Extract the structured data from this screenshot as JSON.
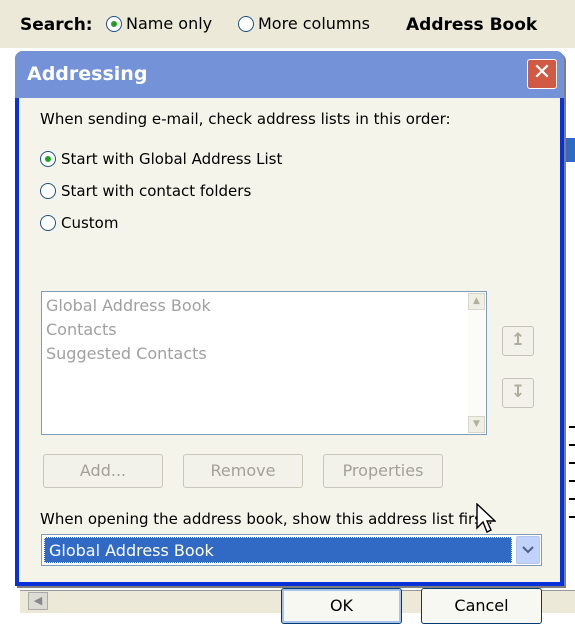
{
  "background": {
    "search_label": "Search:",
    "radio_name_only": "Name only",
    "radio_more_columns": "More columns",
    "title": "Address Book"
  },
  "dialog": {
    "title": "Addressing",
    "close_icon": "close-icon",
    "prompt_order": "When sending e-mail, check address lists in this order:",
    "options": [
      {
        "label": "Start with Global Address List",
        "checked": true
      },
      {
        "label": "Start with contact folders",
        "checked": false
      },
      {
        "label": "Custom",
        "checked": false
      }
    ],
    "list_items": [
      "Global Address Book",
      "Contacts",
      "Suggested Contacts"
    ],
    "move_up_icon": "arrow-up-icon",
    "move_down_icon": "arrow-down-icon",
    "add_label": "Add...",
    "remove_label": "Remove",
    "properties_label": "Properties",
    "prompt_first": "When opening the address book, show this address list first:",
    "first_list_value": "Global Address Book",
    "ok_label": "OK",
    "cancel_label": "Cancel"
  },
  "colors": {
    "title_bar": "#7392d8",
    "selection": "#316ac5",
    "close_button": "#d05a43"
  }
}
